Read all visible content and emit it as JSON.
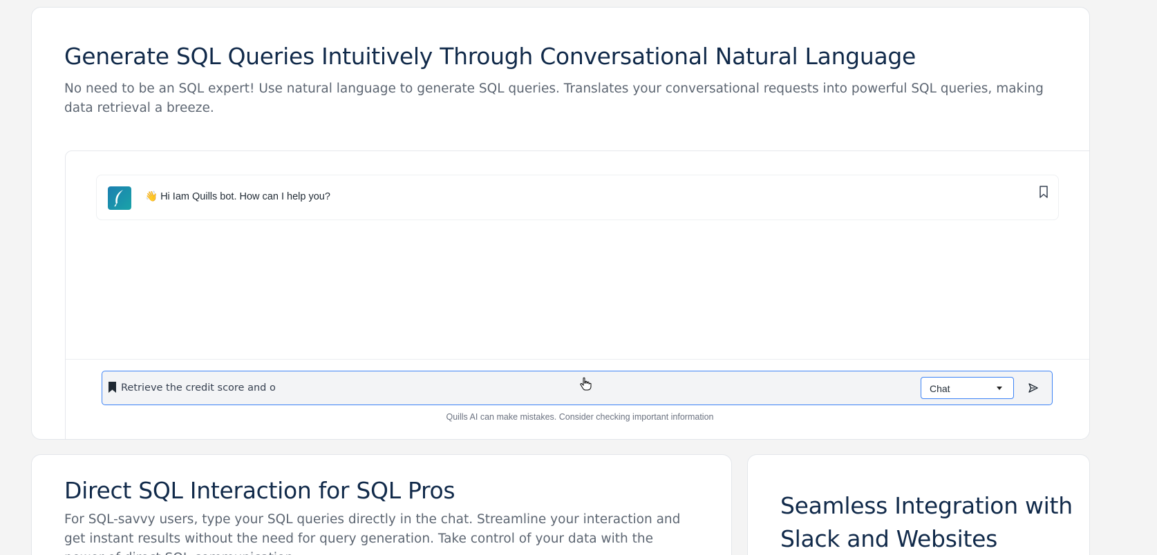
{
  "hero": {
    "title": "Generate SQL Queries Intuitively Through Conversational Natural Language",
    "description": "No need to be an SQL expert! Use natural language to generate SQL queries. Translates your conversational requests into powerful SQL queries, making data retrieval a breeze."
  },
  "chat": {
    "bot_message": "👋 Hi Iam Quills bot. How can I help you?",
    "input_value": "Retrieve the credit score and o",
    "mode_select": "Chat",
    "disclaimer": "Quills AI can make mistakes. Consider checking important information"
  },
  "features": [
    {
      "title": "Direct SQL Interaction for SQL Pros",
      "description": "For SQL-savvy users, type your SQL queries directly in the chat. Streamline your interaction and get instant results without the need for query generation. Take control of your data with the power of direct SQL communication."
    },
    {
      "title": "Seamless Integration with Slack and Websites"
    }
  ],
  "icons": {
    "avatar": "feather-icon",
    "bookmark": "bookmark-icon",
    "send": "send-icon",
    "caret": "chevron-down-icon",
    "cursor": "hand-cursor-icon"
  },
  "colors": {
    "heading": "#112a4a",
    "accent": "#3b82f6",
    "avatar": "#1b8fb0"
  }
}
